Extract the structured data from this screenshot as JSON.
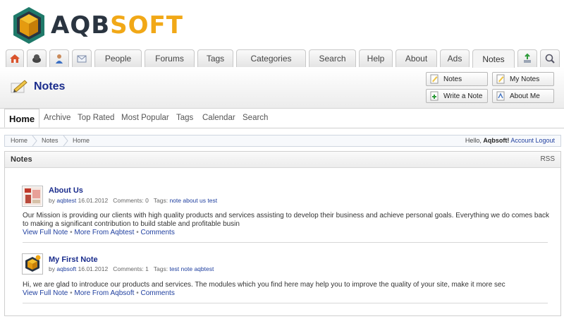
{
  "brand": {
    "part1": "AQB",
    "part2": "SOFT"
  },
  "tabs": {
    "icons": [
      "home-icon",
      "community-icon",
      "profile-icon",
      "mail-icon"
    ],
    "labels": [
      "People",
      "Forums",
      "Tags",
      "Categories",
      "Search",
      "Help",
      "About",
      "Ads",
      "Notes"
    ],
    "active": "Notes",
    "right_icons": [
      "add-icon",
      "search-icon"
    ]
  },
  "header": {
    "title": "Notes",
    "buttons": {
      "notes": "Notes",
      "my_notes": "My Notes",
      "write": "Write a Note",
      "about_me": "About Me"
    }
  },
  "subnav": [
    "Home",
    "Archive",
    "Top Rated",
    "Most Popular",
    "Tags",
    "Calendar",
    "Search"
  ],
  "breadcrumb": {
    "items": [
      "Home",
      "Notes",
      "Home"
    ],
    "hello": "Hello, ",
    "user": "Aqbsoft!",
    "account": "Account",
    "logout": "Logout"
  },
  "panel": {
    "title": "Notes",
    "rss": "RSS"
  },
  "notes": [
    {
      "title": "About Us",
      "by": "by",
      "author": "aqbtest",
      "date": "16.01.2012",
      "comments": "Comments: 0",
      "tags_label": "Tags:",
      "tags": [
        "note",
        "about us",
        "test"
      ],
      "body": "Our Mission is providing our clients with high quality products and services assisting to develop their business and achieve personal goals. Everything we do comes back to making a significant contribution to build stable and profitable busin",
      "actions": {
        "full": "View Full Note",
        "more": "More From Aqbtest",
        "comments": "Comments"
      }
    },
    {
      "title": "My First Note",
      "by": "by",
      "author": "aqbsoft",
      "date": "16.01.2012",
      "comments": "Comments: 1",
      "tags_label": "Tags:",
      "tags": [
        "test",
        "note",
        "aqbtest"
      ],
      "body": "Hi, we are glad to introduce our products and services.   The modules which you find here may help you to improve the quality of your site, make it more sec",
      "actions": {
        "full": "View Full Note",
        "more": "More From Aqbsoft",
        "comments": "Comments"
      }
    }
  ],
  "colors": {
    "title_blue": "#1a2c8c",
    "link_blue": "#1f3f9f",
    "logo_orange": "#f1a817",
    "logo_green": "#1f7a6a"
  }
}
